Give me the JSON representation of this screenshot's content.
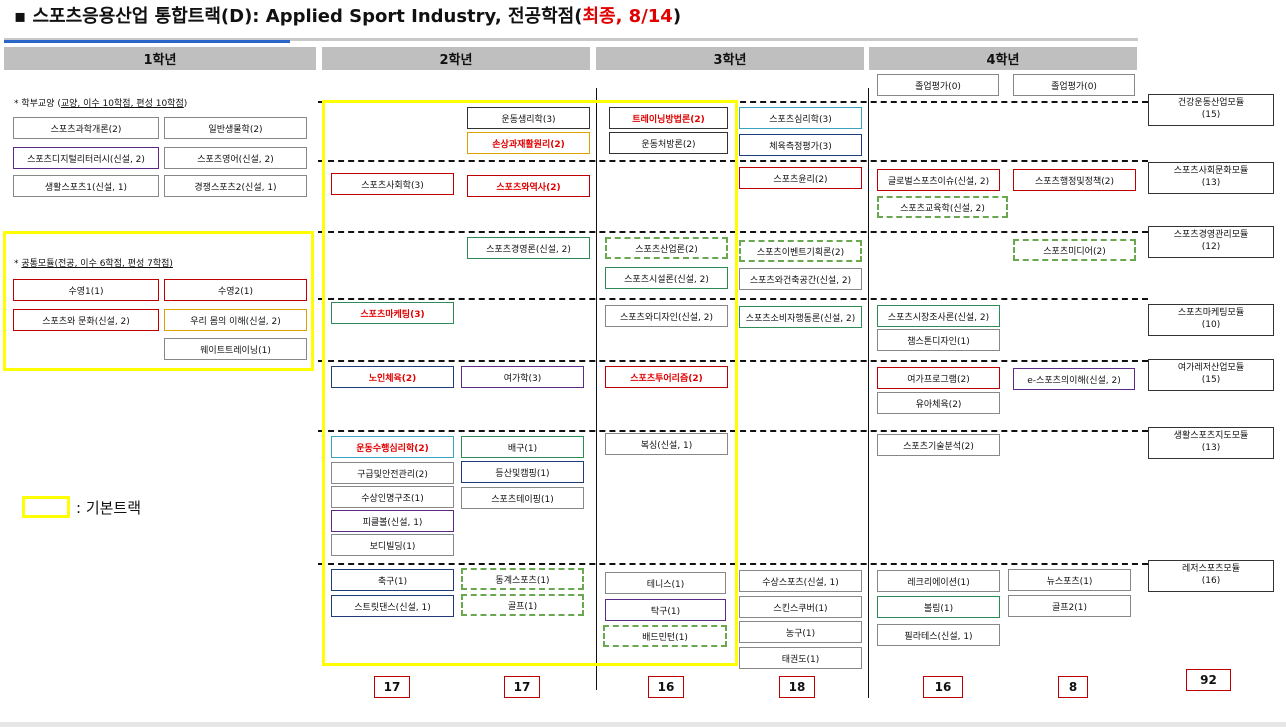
{
  "title": {
    "bullet": "▪",
    "main": "스포츠응용산업 통합트랙(D):  Applied  Sport  Industry,  전공학점(",
    "red": "최종,  8/14",
    "tail": ")"
  },
  "years": [
    "1학년",
    "2학년",
    "3학년",
    "4학년"
  ],
  "graduation": [
    "졸업평가(0)",
    "졸업평가(0)"
  ],
  "labels": {
    "liberal": {
      "prefix": "* 학부교양 (",
      "underlined": "교양, 이수 10학점, 편성 10학점",
      "suffix": ")"
    },
    "common": {
      "prefix": "* ",
      "underlined": "공통모듈(전공, 이수 6학점, 편성 7학점)"
    }
  },
  "year1": {
    "liberal": [
      "스포츠과학개론(2)",
      "일반생물학(2)",
      "스포츠디지털리터러시(신설, 2)",
      "스포츠영어(신설, 2)",
      "생활스포츠1(신설, 1)",
      "경쟁스포츠2(신설, 1)"
    ],
    "common": [
      "수영1(1)",
      "수영2(1)",
      "스포츠와 문화(신설, 2)",
      "우리 몸의 이해(신설, 2)",
      "웨이트트레이닝(1)"
    ]
  },
  "courses": {
    "r1": [
      "운동생리학(3)",
      "손상과재활원리(2)",
      "트레이닝방법론(2)",
      "운동처방론(2)",
      "스포츠심리학(3)",
      "체육측정평가(3)"
    ],
    "r2": [
      "스포츠사회학(3)",
      "스포츠와역사(2)",
      "스포츠윤리(2)",
      "글로벌스포츠이슈(신설, 2)",
      "스포츠행정및정책(2)",
      "스포츠교육학(신설, 2)"
    ],
    "r3": [
      "스포츠경영론(신설, 2)",
      "스포츠산업론(2)",
      "스포츠이벤트기획론(2)",
      "스포츠미디어(2)",
      "스포츠시설론(신설, 2)",
      "스포츠와건축공간(신설, 2)"
    ],
    "r4": [
      "스포츠마케팅(3)",
      "스포츠와디자인(신설, 2)",
      "스포츠소비자행동론(신설, 2)",
      "스포츠시장조사론(신설, 2)",
      "챔스톤디자인(1)"
    ],
    "r5": [
      "노인체육(2)",
      "여가학(3)",
      "스포츠투어리즘(2)",
      "여가프로그램(2)",
      "e-스포츠의이해(신설, 2)",
      "유아체육(2)"
    ],
    "r6": [
      "운동수행심리학(2)",
      "배구(1)",
      "복싱(신설, 1)",
      "스포츠기술분석(2)",
      "구급및안전관리(2)",
      "등산및캠핑(1)",
      "수상인명구조(1)",
      "스포츠테이핑(1)",
      "피클볼(신설, 1)",
      "보디빌딩(1)"
    ],
    "r7": [
      "축구(1)",
      "동계스포츠(1)",
      "테니스(1)",
      "수상스포츠(신설, 1)",
      "레크리에이션(1)",
      "뉴스포츠(1)",
      "스트릿댄스(신설, 1)",
      "골프(1)",
      "탁구(1)",
      "스킨스쿠버(1)",
      "볼링(1)",
      "골프2(1)",
      "배드민턴(1)",
      "농구(1)",
      "필라테스(신설, 1)",
      "태권도(1)"
    ]
  },
  "modules": [
    "건강운동산업모듈\n(15)",
    "스포츠사회문화모듈\n(13)",
    "스포츠경영관리모듈\n(12)",
    "스포츠마케팅모듈\n(10)",
    "여가레저산업모듈\n(15)",
    "생활스포츠지도모듈\n(13)",
    "레저스포츠모듈\n(16)"
  ],
  "totals": [
    "17",
    "17",
    "16",
    "18",
    "16",
    "8",
    "92"
  ],
  "legend": ": 기본트랙",
  "colors": {
    "red": "#e00000",
    "yellow": "#ffff00",
    "header_gray": "#bfbfbf",
    "dashed_green": "#6aa84f",
    "blue_bar": "#2a66c9"
  }
}
